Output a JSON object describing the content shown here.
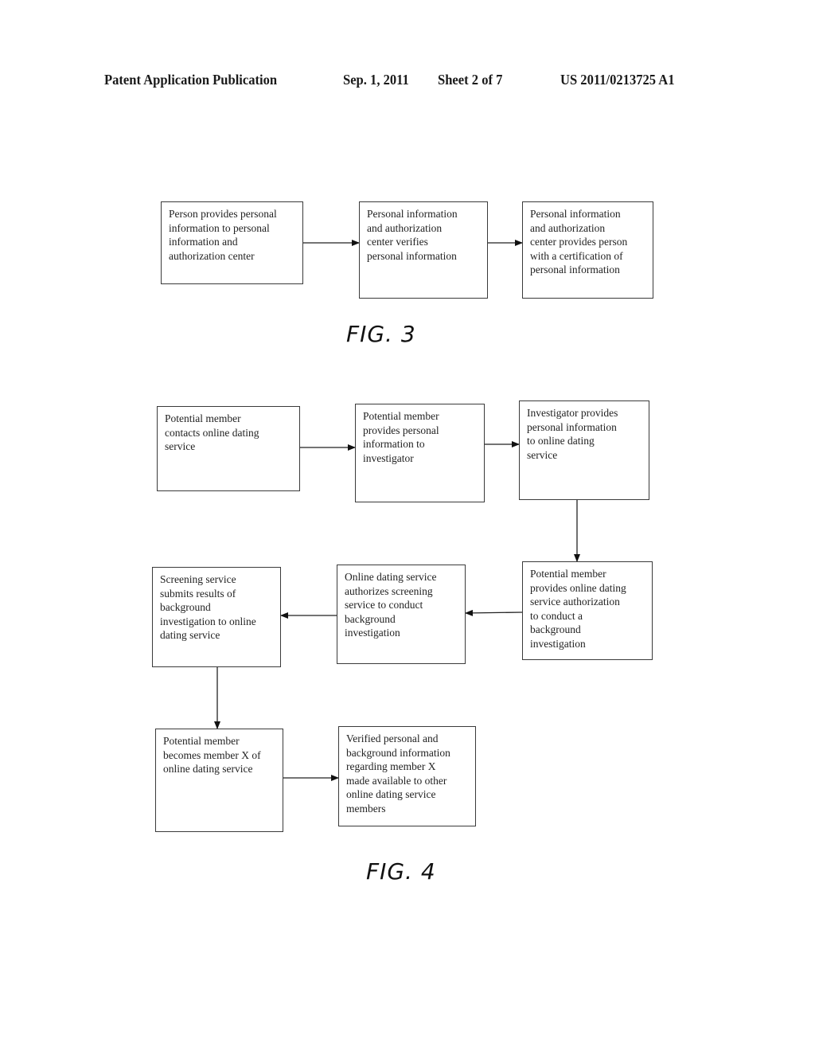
{
  "header": {
    "publication": "Patent Application Publication",
    "date": "Sep. 1, 2011",
    "sheet": "Sheet 2 of 7",
    "number": "US 2011/0213725 A1"
  },
  "fig3": {
    "label": "FIG. 3",
    "boxes": [
      {
        "text": "Person provides personal\ninformation to  personal\ninformation and\nauthorization center"
      },
      {
        "text": "Personal information\nand authorization\ncenter verifies\npersonal information"
      },
      {
        "text": "Personal information\nand authorization\ncenter provides person\nwith a certification of\npersonal information"
      }
    ]
  },
  "fig4": {
    "label": "FIG. 4",
    "boxes": [
      {
        "text": "Potential member\ncontacts online dating\nservice"
      },
      {
        "text": "Potential member\nprovides personal\ninformation to\ninvestigator"
      },
      {
        "text": "Investigator provides\npersonal information\nto online dating\nservice"
      },
      {
        "text": "Potential member\nprovides online dating\nservice authorization\nto conduct a\nbackground\ninvestigation"
      },
      {
        "text": "Online dating service\nauthorizes screening\nservice to conduct\nbackground\ninvestigation"
      },
      {
        "text": "Screening service\nsubmits results of\nbackground\ninvestigation to online\ndating service"
      },
      {
        "text": "Potential member\nbecomes member X of\nonline dating service"
      },
      {
        "text": "Verified personal and\nbackground information\nregarding member X\nmade available to other\nonline dating service\nmembers"
      }
    ]
  }
}
